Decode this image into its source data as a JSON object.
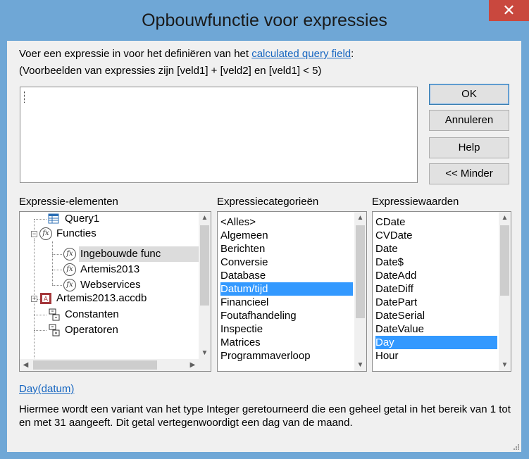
{
  "dialog": {
    "title": "Opbouwfunctie voor expressies",
    "close_glyph": "✕"
  },
  "instructions": {
    "line1_prefix": "Voer een expressie in voor het definiëren van het ",
    "line1_link": "calculated query field",
    "line1_suffix": ":",
    "line2": "(Voorbeelden van expressies zijn [veld1] + [veld2] en [veld1] < 5)"
  },
  "expression": {
    "value": ""
  },
  "buttons": {
    "ok": "OK",
    "cancel": "Annuleren",
    "help": "Help",
    "less": "<< Minder"
  },
  "panels": {
    "elements_label": "Expressie-elementen",
    "categories_label": "Expressiecategorieën",
    "values_label": "Expressiewaarden"
  },
  "tree": {
    "items": [
      {
        "label": "Query1",
        "icon": "query-icon"
      },
      {
        "label": "Functies",
        "icon": "function-icon"
      },
      {
        "label": "Ingebouwde func",
        "icon": "function-icon"
      },
      {
        "label": "Artemis2013",
        "icon": "function-icon"
      },
      {
        "label": "Webservices",
        "icon": "function-icon"
      },
      {
        "label": "Artemis2013.accdb",
        "icon": "database-icon"
      },
      {
        "label": "Constanten",
        "icon": "constants-icon"
      },
      {
        "label": "Operatoren",
        "icon": "operators-icon"
      }
    ],
    "selected_index": 2
  },
  "categories": {
    "items": [
      "<Alles>",
      "Algemeen",
      "Berichten",
      "Conversie",
      "Database",
      "Datum/tijd",
      "Financieel",
      "Foutafhandeling",
      "Inspectie",
      "Matrices",
      "Programmaverloop"
    ],
    "selected_index": 5
  },
  "values": {
    "items": [
      "CDate",
      "CVDate",
      "Date",
      "Date$",
      "DateAdd",
      "DateDiff",
      "DatePart",
      "DateSerial",
      "DateValue",
      "Day",
      "Hour"
    ],
    "selected_index": 9
  },
  "help_info": {
    "syntax_link": "Day(datum)",
    "description": "Hiermee wordt een variant van het type Integer geretourneerd die een geheel getal in het bereik van 1 tot en met 31 aangeeft. Dit getal vertegenwoordigt een dag van de maand."
  },
  "colors": {
    "titlebar": "#6fa7d6",
    "close_button": "#c9483e",
    "selection": "#3399ff",
    "link": "#1565c0"
  }
}
